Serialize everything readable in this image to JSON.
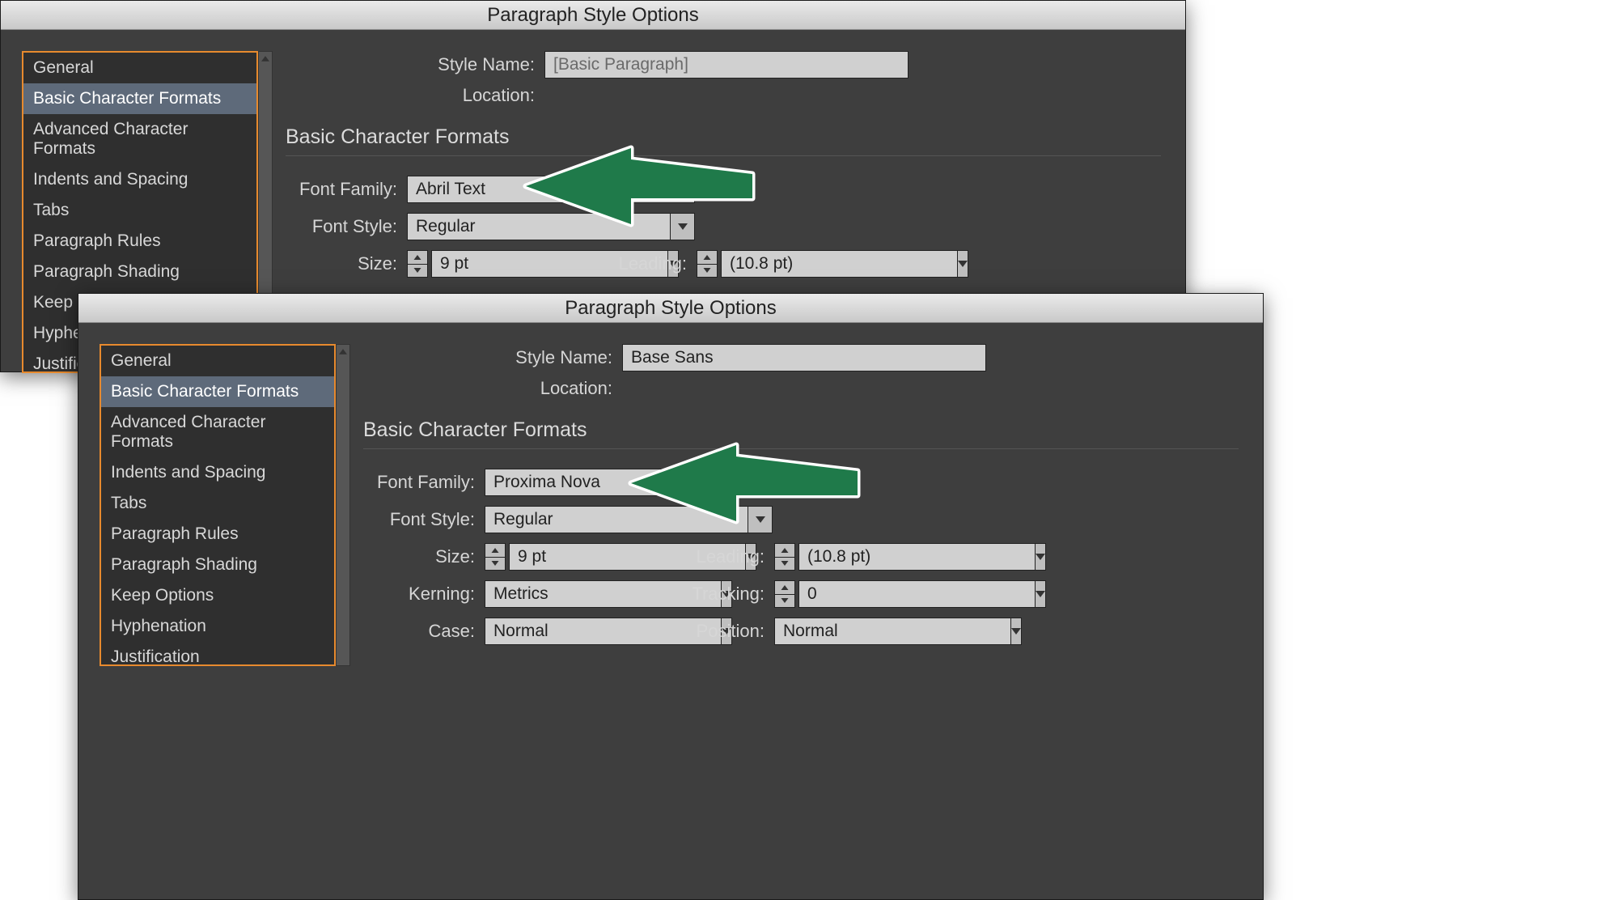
{
  "dialog1": {
    "title": "Paragraph Style Options",
    "styleNameLabel": "Style Name:",
    "styleNameValue": "[Basic Paragraph]",
    "locationLabel": "Location:",
    "sectionHeading": "Basic Character Formats",
    "sidebar": {
      "items": [
        "General",
        "Basic Character Formats",
        "Advanced Character Formats",
        "Indents and Spacing",
        "Tabs",
        "Paragraph Rules",
        "Paragraph Shading",
        "Keep Options",
        "Hypher",
        "Justifica"
      ],
      "selectedIndex": 1
    },
    "fields": {
      "fontFamilyLabel": "Font Family:",
      "fontFamilyValue": "Abril Text",
      "fontStyleLabel": "Font Style:",
      "fontStyleValue": "Regular",
      "sizeLabel": "Size:",
      "sizeValue": "9 pt",
      "leadingLabel": "Leading:",
      "leadingValue": "(10.8 pt)"
    }
  },
  "dialog2": {
    "title": "Paragraph Style Options",
    "styleNameLabel": "Style Name:",
    "styleNameValue": "Base Sans",
    "locationLabel": "Location:",
    "sectionHeading": "Basic Character Formats",
    "sidebar": {
      "items": [
        "General",
        "Basic Character Formats",
        "Advanced Character Formats",
        "Indents and Spacing",
        "Tabs",
        "Paragraph Rules",
        "Paragraph Shading",
        "Keep Options",
        "Hyphenation",
        "Justification"
      ],
      "selectedIndex": 1
    },
    "fields": {
      "fontFamilyLabel": "Font Family:",
      "fontFamilyValue": "Proxima Nova",
      "fontStyleLabel": "Font Style:",
      "fontStyleValue": "Regular",
      "sizeLabel": "Size:",
      "sizeValue": "9 pt",
      "leadingLabel": "Leading:",
      "leadingValue": "(10.8 pt)",
      "kerningLabel": "Kerning:",
      "kerningValue": "Metrics",
      "trackingLabel": "Tracking:",
      "trackingValue": "0",
      "caseLabel": "Case:",
      "caseValue": "Normal",
      "positionLabel": "Position:",
      "positionValue": "Normal"
    }
  },
  "arrowColor": "#1f7a4a"
}
